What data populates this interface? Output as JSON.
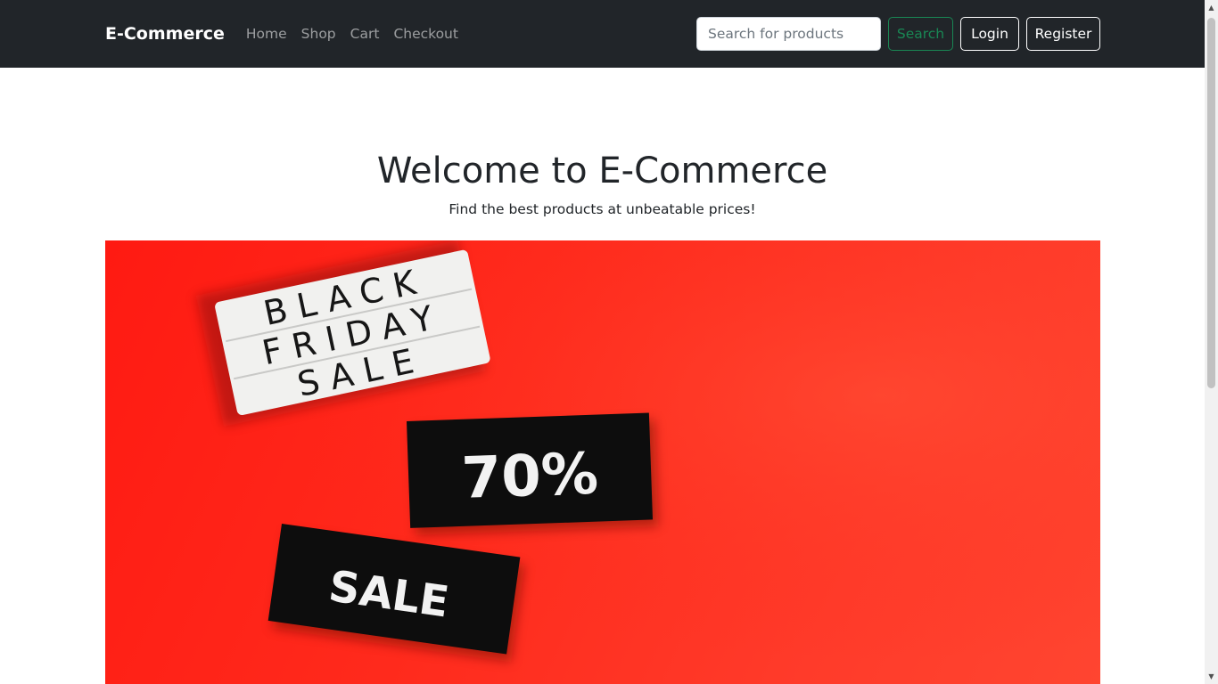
{
  "navbar": {
    "brand": "E-Commerce",
    "links": [
      {
        "label": "Home"
      },
      {
        "label": "Shop"
      },
      {
        "label": "Cart"
      },
      {
        "label": "Checkout"
      }
    ],
    "search": {
      "placeholder": "Search for products",
      "value": "",
      "button_label": "Search"
    },
    "login_label": "Login",
    "register_label": "Register"
  },
  "hero": {
    "title": "Welcome to E-Commerce",
    "subtitle": "Find the best products at unbeatable prices!"
  },
  "banner": {
    "lightbox_text": [
      "BLACK",
      "FRIDAY",
      "SALE"
    ],
    "card1_text": "70%",
    "card2_text": "SALE"
  },
  "colors": {
    "navbar_bg": "#212529",
    "search_accent": "#198754",
    "banner_red": "#ff2a1c"
  }
}
